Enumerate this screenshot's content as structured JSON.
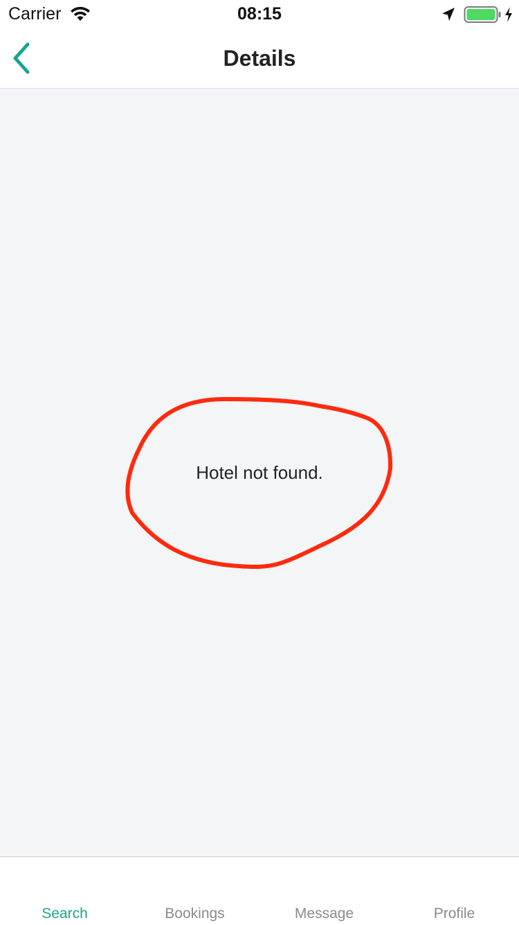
{
  "status_bar": {
    "carrier": "Carrier",
    "time": "08:15",
    "wifi_icon": "wifi-icon",
    "location_icon": "location-arrow-icon",
    "battery_icon": "battery-full-icon",
    "charging_icon": "lightning-bolt-icon",
    "battery_color": "#4cd964"
  },
  "nav_bar": {
    "title": "Details",
    "back_icon": "chevron-left-icon",
    "accent_color": "#1aa48f"
  },
  "content": {
    "message": "Hotel not found.",
    "background_color": "#f4f5f7",
    "annotation_color": "#ff2a0d"
  },
  "tab_bar": {
    "tabs": [
      {
        "label": "Search",
        "active": true
      },
      {
        "label": "Bookings",
        "active": false
      },
      {
        "label": "Message",
        "active": false
      },
      {
        "label": "Profile",
        "active": false
      }
    ]
  }
}
